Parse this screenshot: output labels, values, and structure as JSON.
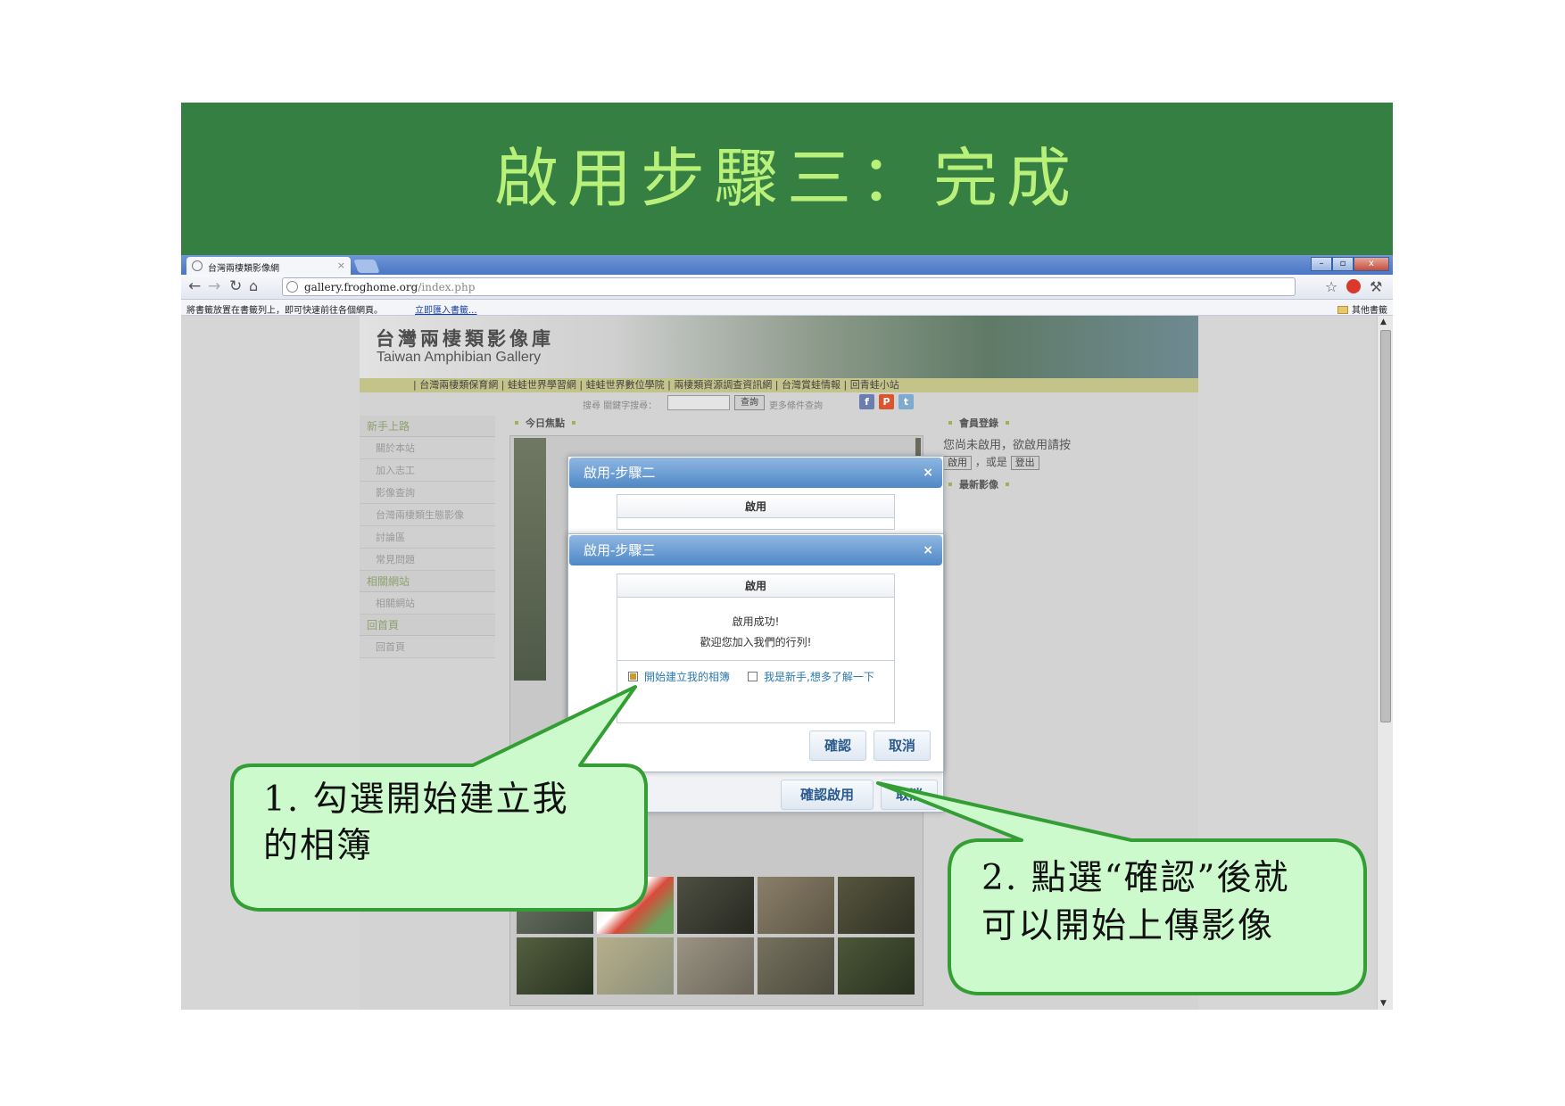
{
  "banner": {
    "title": "啟用步驟三：完成"
  },
  "browser": {
    "tab_title": "台灣兩棲類影像網",
    "tab_close": "×",
    "url_host": "gallery.froghome.org",
    "url_path": "/index.php",
    "window_controls": {
      "minimize": "–",
      "restore": "▫",
      "close": "x"
    },
    "bookmarks_message": "將書籤放置在書籤列上，即可快速前往各個網頁。",
    "bookmarks_import": "立即匯入書籤...",
    "other_bookmarks": "其他書籤"
  },
  "site": {
    "logo_zh": "台灣兩棲類影像庫",
    "logo_en": "Taiwan Amphibian Gallery",
    "nav": [
      "台灣兩棲類保育網",
      "蛙蛙世界學習網",
      "蛙蛙世界數位學院",
      "兩棲類資源調查資訊網",
      "台灣賞蛙情報",
      "回青蛙小站"
    ],
    "search_label": "搜尋 關鍵字搜尋：",
    "search_button": "查詢",
    "search_more": "更多條件查詢",
    "social": {
      "facebook": "f",
      "plurk": "P",
      "twitter": "t"
    },
    "side_menu": [
      {
        "head": "新手上路",
        "items": [
          "關於本站",
          "加入志工",
          "影像查詢",
          "台灣兩棲類生態影像",
          "討論區",
          "常見問題"
        ]
      },
      {
        "head": "相關網站",
        "items": [
          "相關網站"
        ]
      },
      {
        "head": "回首頁",
        "items": [
          "回首頁"
        ]
      }
    ],
    "today_focus": "今日焦點",
    "member": {
      "head": "會員登錄",
      "message": "您尚未啟用，欲啟用請按",
      "enable_button": "啟用",
      "or": "，或是",
      "logout_button": "登出"
    },
    "latest_images": "最新影像"
  },
  "dialog_step2": {
    "title": "啟用-步驟二",
    "close": "×",
    "inner_head": "啟用",
    "confirm_button": "確認啟用",
    "cancel_button": "取消"
  },
  "dialog_step3": {
    "title": "啟用-步驟三",
    "close": "×",
    "inner_head": "啟用",
    "message_line1": "啟用成功!",
    "message_line2": "歡迎您加入我們的行列!",
    "option_create_album": "開始建立我的相簿",
    "option_newbie": "我是新手,想多了解一下",
    "confirm_button": "確認",
    "cancel_button": "取消"
  },
  "callouts": {
    "step1_line1": "1. 勾選開始建立我",
    "step1_line2": "的相簿",
    "step2_line1": "2. 點選“確認”後就",
    "step2_line2": "可以開始上傳影像"
  },
  "colors": {
    "banner_bg": "#357f42",
    "banner_text": "#b8f07a",
    "callout_fill": "#cdfacd",
    "callout_stroke": "#339e33",
    "dialog_title": "#5b93cd"
  }
}
